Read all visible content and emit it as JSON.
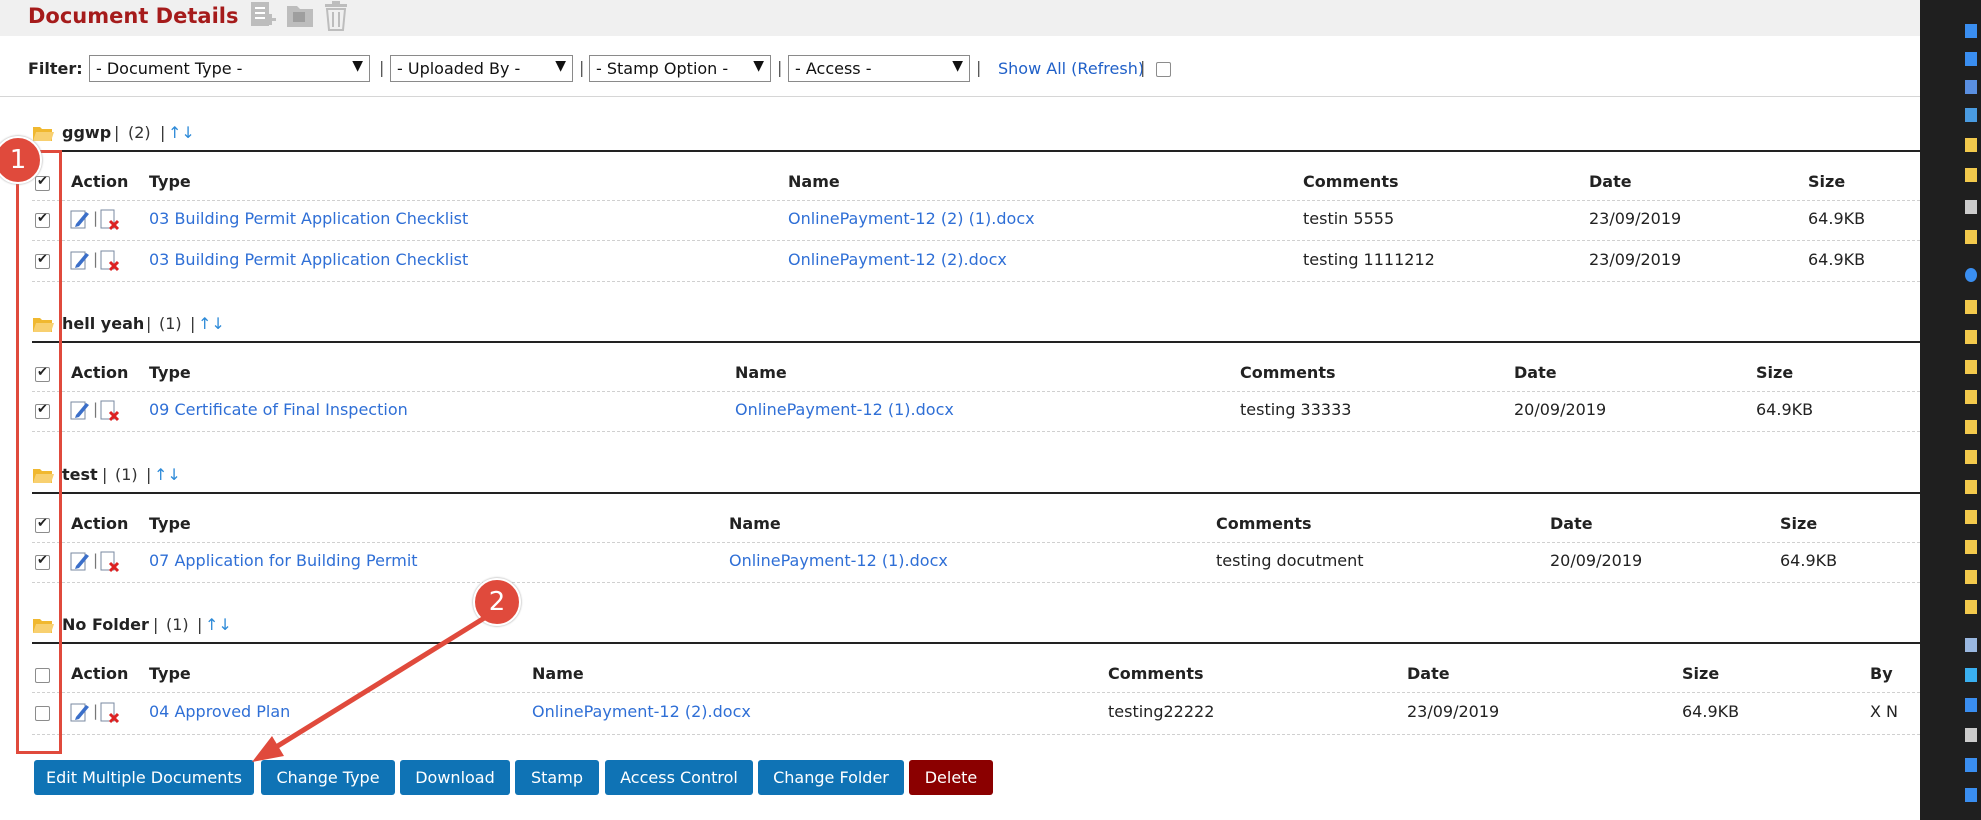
{
  "header": {
    "title": "Document Details"
  },
  "filter": {
    "label": "Filter:",
    "document_type": "- Document Type -",
    "uploaded_by": "- Uploaded By -",
    "stamp_option": "- Stamp Option -",
    "access": "- Access -",
    "show_all": "Show All (Refresh)",
    "separator": "|"
  },
  "columns": {
    "action": "Action",
    "type": "Type",
    "name": "Name",
    "comments": "Comments",
    "date": "Date",
    "size": "Size",
    "by": "By"
  },
  "groups": [
    {
      "name": "ggwp",
      "count": "(2)",
      "separator": "|",
      "rows": [
        {
          "type": "03 Building Permit Application Checklist",
          "name": "OnlinePayment-12 (2) (1).docx",
          "comments": "testin 5555",
          "date": "23/09/2019",
          "size": "64.9KB"
        },
        {
          "type": "03 Building Permit Application Checklist",
          "name": "OnlinePayment-12 (2).docx",
          "comments": "testing 1111212",
          "date": "23/09/2019",
          "size": "64.9KB"
        }
      ]
    },
    {
      "name": "hell yeah",
      "count": "(1)",
      "separator": "|",
      "rows": [
        {
          "type": "09 Certificate of Final Inspection",
          "name": "OnlinePayment-12 (1).docx",
          "comments": "testing 33333",
          "date": "20/09/2019",
          "size": "64.9KB"
        }
      ]
    },
    {
      "name": "test",
      "count": "(1)",
      "separator": "|",
      "rows": [
        {
          "type": "07 Application for Building Permit",
          "name": "OnlinePayment-12 (1).docx",
          "comments": "testing docutment",
          "date": "20/09/2019",
          "size": "64.9KB"
        }
      ]
    },
    {
      "name": "No Folder",
      "count": "(1)",
      "separator": "|",
      "rows": [
        {
          "type": "04 Approved Plan",
          "name": "OnlinePayment-12 (2).docx",
          "comments": "testing22222",
          "date": "23/09/2019",
          "size": "64.9KB",
          "by": "X N"
        }
      ]
    }
  ],
  "buttons": {
    "edit_multiple": "Edit Multiple Documents",
    "change_type": "Change Type",
    "download": "Download",
    "stamp": "Stamp",
    "access_control": "Access Control",
    "change_folder": "Change Folder",
    "delete": "Delete"
  },
  "annotations": {
    "badge_1": "1",
    "badge_2": "2"
  },
  "colors": {
    "title": "#a51b1b",
    "link": "#2f6fd6",
    "button": "#0f73b5",
    "delete": "#8b0000",
    "annotation": "#e04a3c"
  },
  "icons": [
    "add-document-icon",
    "folder-icon",
    "trash-icon",
    "edit-icon",
    "delete-file-icon",
    "sort-icon"
  ]
}
